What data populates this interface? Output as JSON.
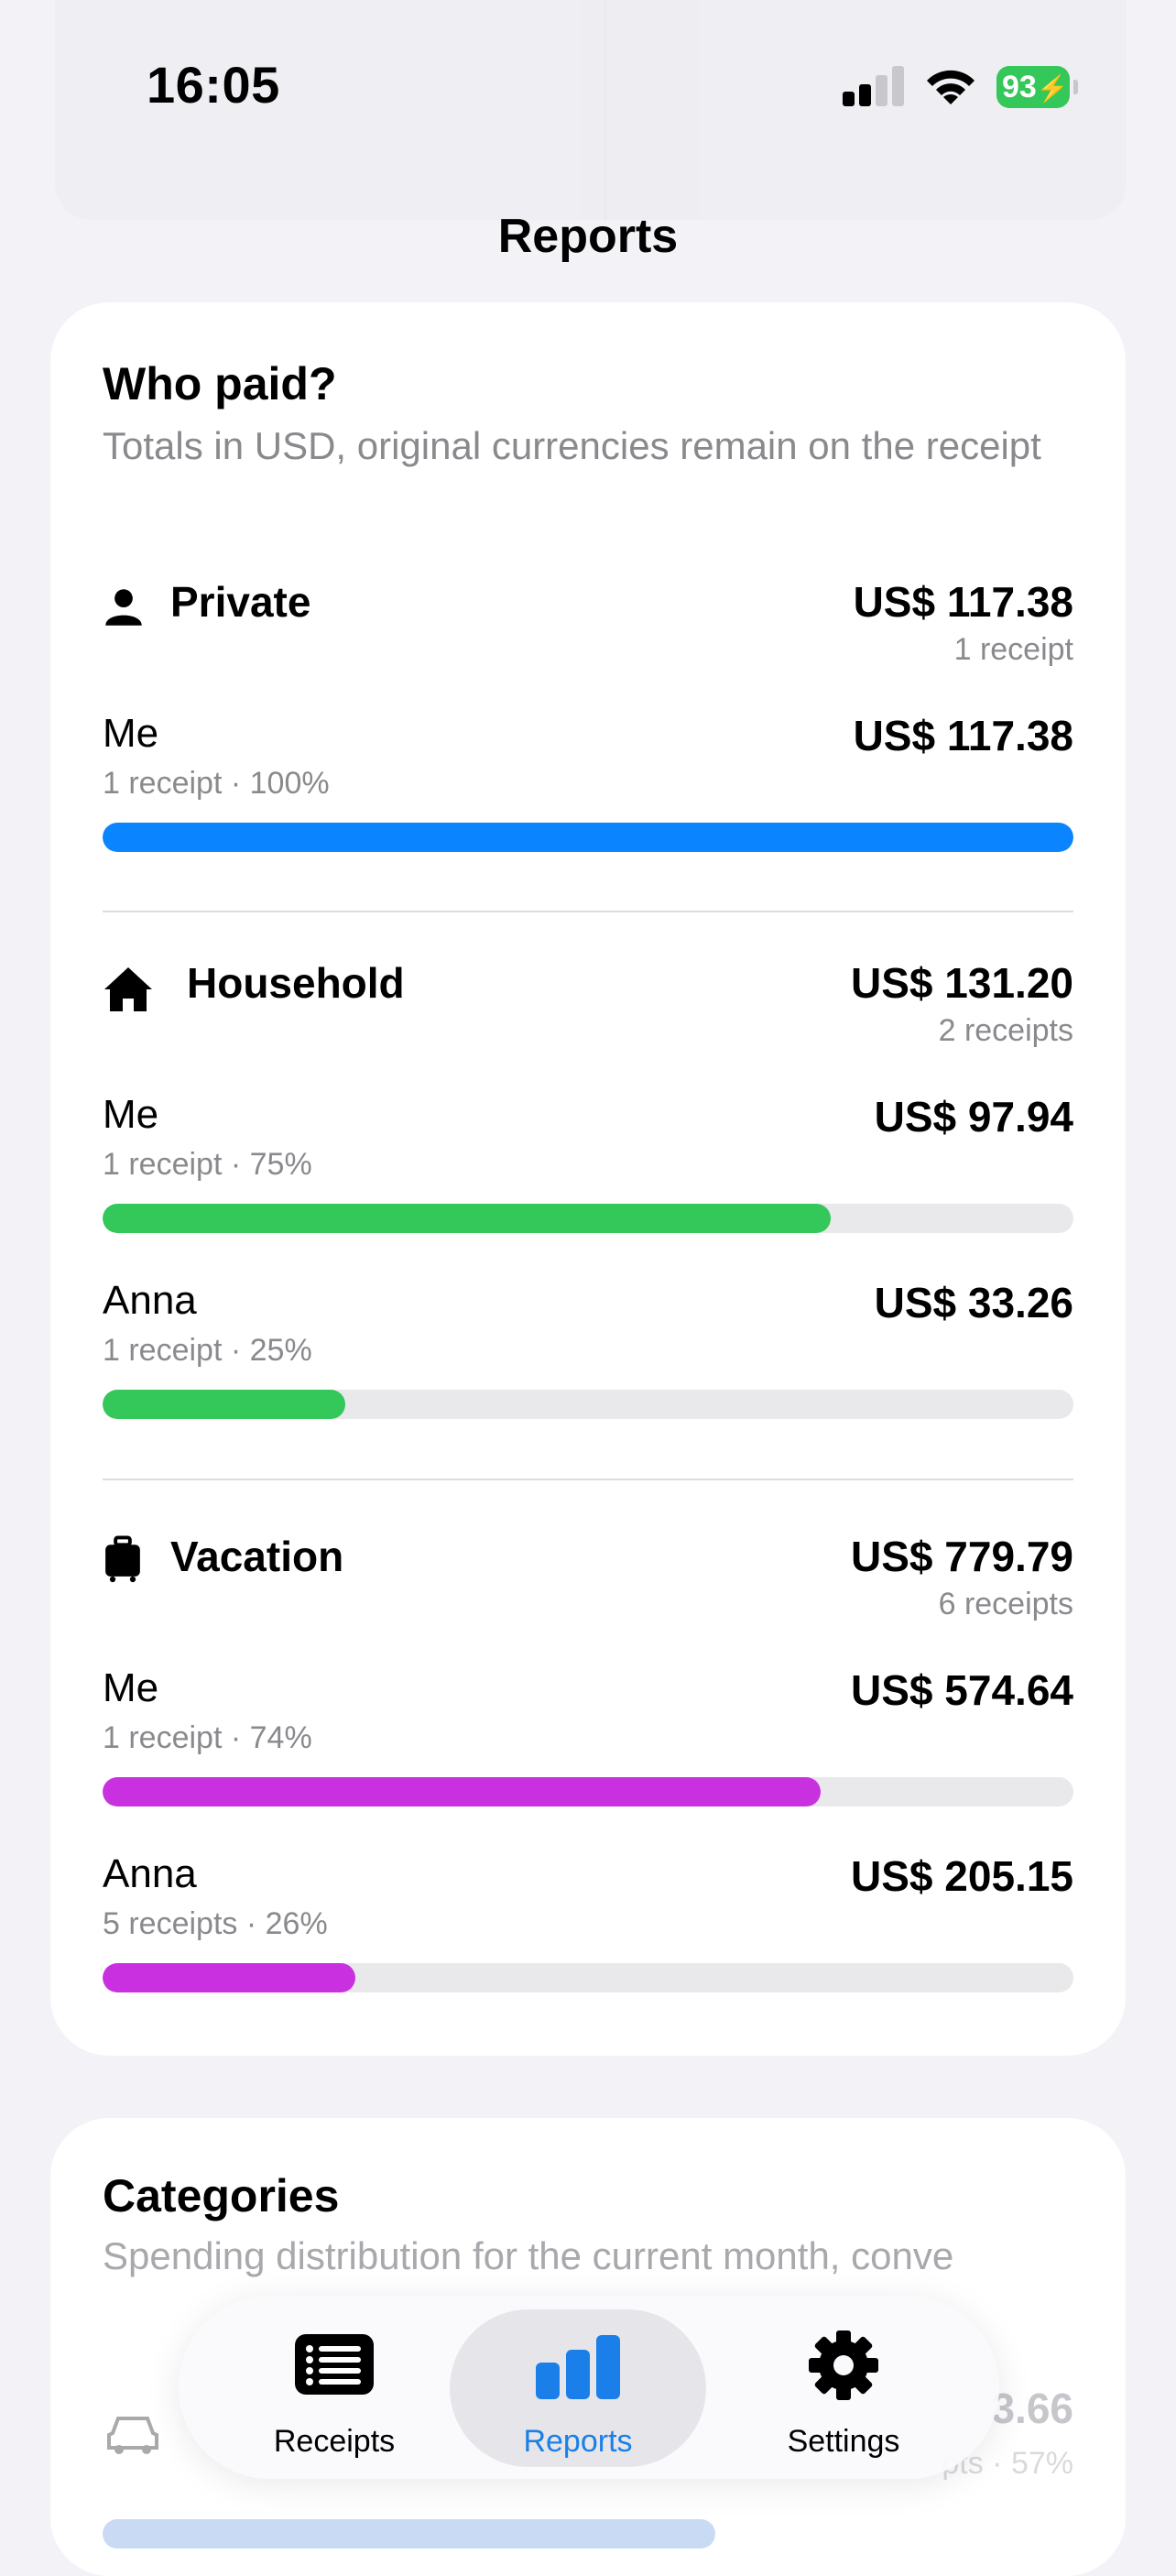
{
  "status_bar": {
    "time": "16:05",
    "battery": "93"
  },
  "nav": {
    "title": "Reports"
  },
  "who_paid": {
    "title": "Who paid?",
    "subtitle": "Totals in USD, original currencies remain on the receipt",
    "groups": [
      {
        "name": "Private",
        "icon": "person-icon",
        "total": "US$ 117.38",
        "count": "1 receipt",
        "color": "#0a84ff",
        "members": [
          {
            "name": "Me",
            "amount": "US$ 117.38",
            "meta": "1 receipt · 100%",
            "share": 1.0
          }
        ]
      },
      {
        "name": "Household",
        "icon": "house-icon",
        "total": "US$ 131.20",
        "count": "2 receipts",
        "color": "#34c759",
        "members": [
          {
            "name": "Me",
            "amount": "US$ 97.94",
            "meta": "1 receipt · 75%",
            "share": 0.75
          },
          {
            "name": "Anna",
            "amount": "US$ 33.26",
            "meta": "1 receipt · 25%",
            "share": 0.25
          }
        ]
      },
      {
        "name": "Vacation",
        "icon": "suitcase-icon",
        "total": "US$ 779.79",
        "count": "6 receipts",
        "color": "#c931e0",
        "members": [
          {
            "name": "Me",
            "amount": "US$ 574.64",
            "meta": "1 receipt · 74%",
            "share": 0.74
          },
          {
            "name": "Anna",
            "amount": "US$ 205.15",
            "meta": "5 receipts · 26%",
            "share": 0.26
          }
        ]
      }
    ]
  },
  "categories": {
    "title": "Categories",
    "subtitle": "Spending distribution for the current month, conve",
    "first_item": {
      "icon": "car-icon",
      "amount": "3.66",
      "meta": "pts · 57%",
      "share": 0.57
    }
  },
  "tab_bar": {
    "tabs": [
      {
        "label": "Receipts",
        "icon": "list-icon",
        "active": false
      },
      {
        "label": "Reports",
        "icon": "bar-chart-icon",
        "active": true
      },
      {
        "label": "Settings",
        "icon": "gear-icon",
        "active": false
      }
    ]
  }
}
